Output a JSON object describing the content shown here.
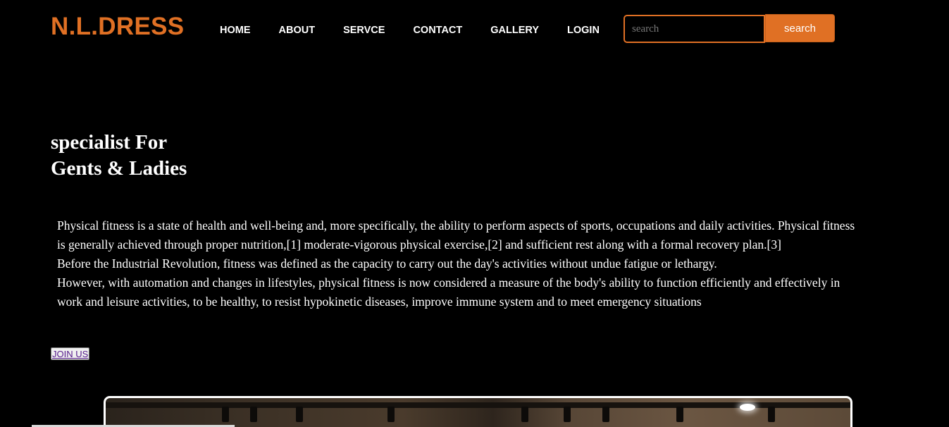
{
  "brand": {
    "name": "N.L.DRESS",
    "color": "#e07024"
  },
  "nav": {
    "items": [
      {
        "label": "HOME"
      },
      {
        "label": "ABOUT"
      },
      {
        "label": "SERVCE"
      },
      {
        "label": "CONTACT"
      },
      {
        "label": "GALLERY"
      },
      {
        "label": "LOGIN"
      }
    ]
  },
  "search": {
    "placeholder": "search",
    "value": "",
    "button_label": "search"
  },
  "hero": {
    "title_line1": "specialist For",
    "title_line2": "Gents & Ladies"
  },
  "intro": {
    "paragraph1": "Physical fitness is a state of health and well-being and, more specifically, the ability to perform aspects of sports, occupations and daily activities. Physical fitness is generally achieved through proper nutrition,[1] moderate-vigorous physical exercise,[2] and sufficient rest along with a formal recovery plan.[3]",
    "paragraph2": "Before the Industrial Revolution, fitness was defined as the capacity to carry out the day's activities without undue fatigue or lethargy.",
    "paragraph3": "However, with automation and changes in lifestyles, physical fitness is now considered a measure of the body's ability to function efficiently and effectively in work and leisure activities, to be healthy, to resist hypokinetic diseases, improve immune system and to meet emergency situations"
  },
  "cta": {
    "join_label": "JOIN US"
  },
  "gallery": {
    "image_name": "gym-interior-image"
  }
}
